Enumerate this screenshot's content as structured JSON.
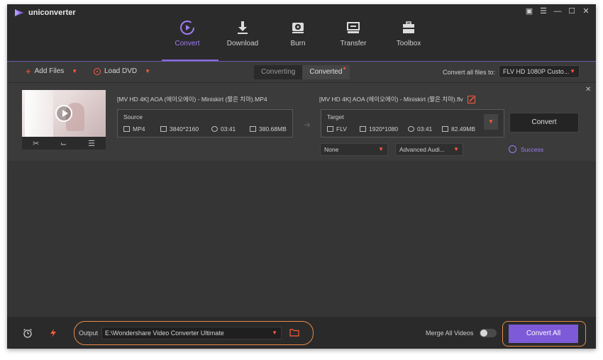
{
  "app": {
    "title": "uniconverter"
  },
  "nav": [
    {
      "label": "Convert",
      "icon": "convert-icon"
    },
    {
      "label": "Download",
      "icon": "download-icon"
    },
    {
      "label": "Burn",
      "icon": "burn-icon"
    },
    {
      "label": "Transfer",
      "icon": "transfer-icon"
    },
    {
      "label": "Toolbox",
      "icon": "toolbox-icon"
    }
  ],
  "toolbar": {
    "add_files": "Add Files",
    "load_dvd": "Load DVD",
    "tab_converting": "Converting",
    "tab_converted": "Converted",
    "convert_all_files_to": "Convert all files to:",
    "format": "FLV HD 1080P Custo..."
  },
  "file": {
    "source_title": "[MV HD 4K] AOA (에이오에이) - Miniskirt (짧은 치마).MP4",
    "target_title": "[MV HD 4K] AOA (에이오에이) - Miniskirt (짧은 치마).flv",
    "source": {
      "label": "Source",
      "format": "MP4",
      "resolution": "3840*2160",
      "duration": "03:41",
      "size": "380.68MB"
    },
    "target": {
      "label": "Target",
      "format": "FLV",
      "resolution": "1920*1080",
      "duration": "03:41",
      "size": "82.49MB"
    },
    "convert_label": "Convert",
    "subtitle_option": "None",
    "audio_option": "Advanced Audi...",
    "status": "Success"
  },
  "bottom": {
    "output_label": "Output",
    "output_path": "E:\\Wondershare Video Converter Ultimate",
    "merge_label": "Merge All Videos",
    "convert_all": "Convert All"
  },
  "colors": {
    "accent": "#8b6be0",
    "orange": "#ff5a3c",
    "highlight_ring": "#e88a4a"
  }
}
